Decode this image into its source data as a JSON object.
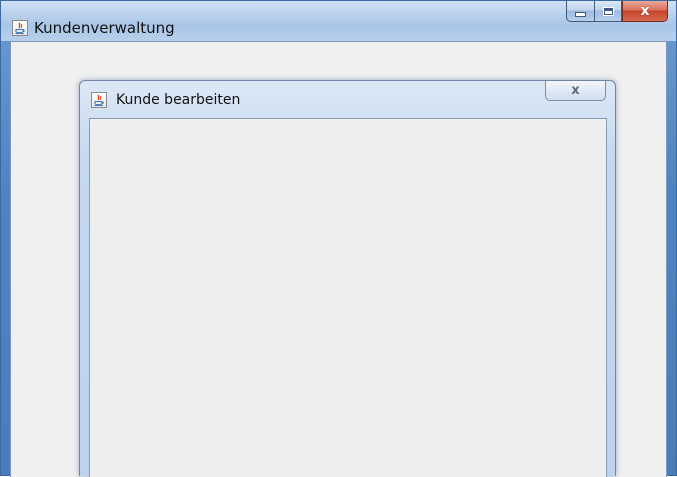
{
  "main_window": {
    "title": "Kundenverwaltung",
    "icon": "java-app-icon",
    "caption_buttons": {
      "minimize_icon": "minimize-icon",
      "maximize_icon": "maximize-icon",
      "close_icon": "close-icon",
      "close_glyph": "x"
    }
  },
  "internal_frame": {
    "title": "Kunde bearbeiten",
    "icon": "java-app-icon",
    "close_icon": "close-icon",
    "close_glyph": "x"
  },
  "colors": {
    "titlebar_active": "#b9d1ec",
    "close_button": "#c4442c",
    "client_background": "#f0f0f0",
    "frame_background": "#eeeeee"
  }
}
